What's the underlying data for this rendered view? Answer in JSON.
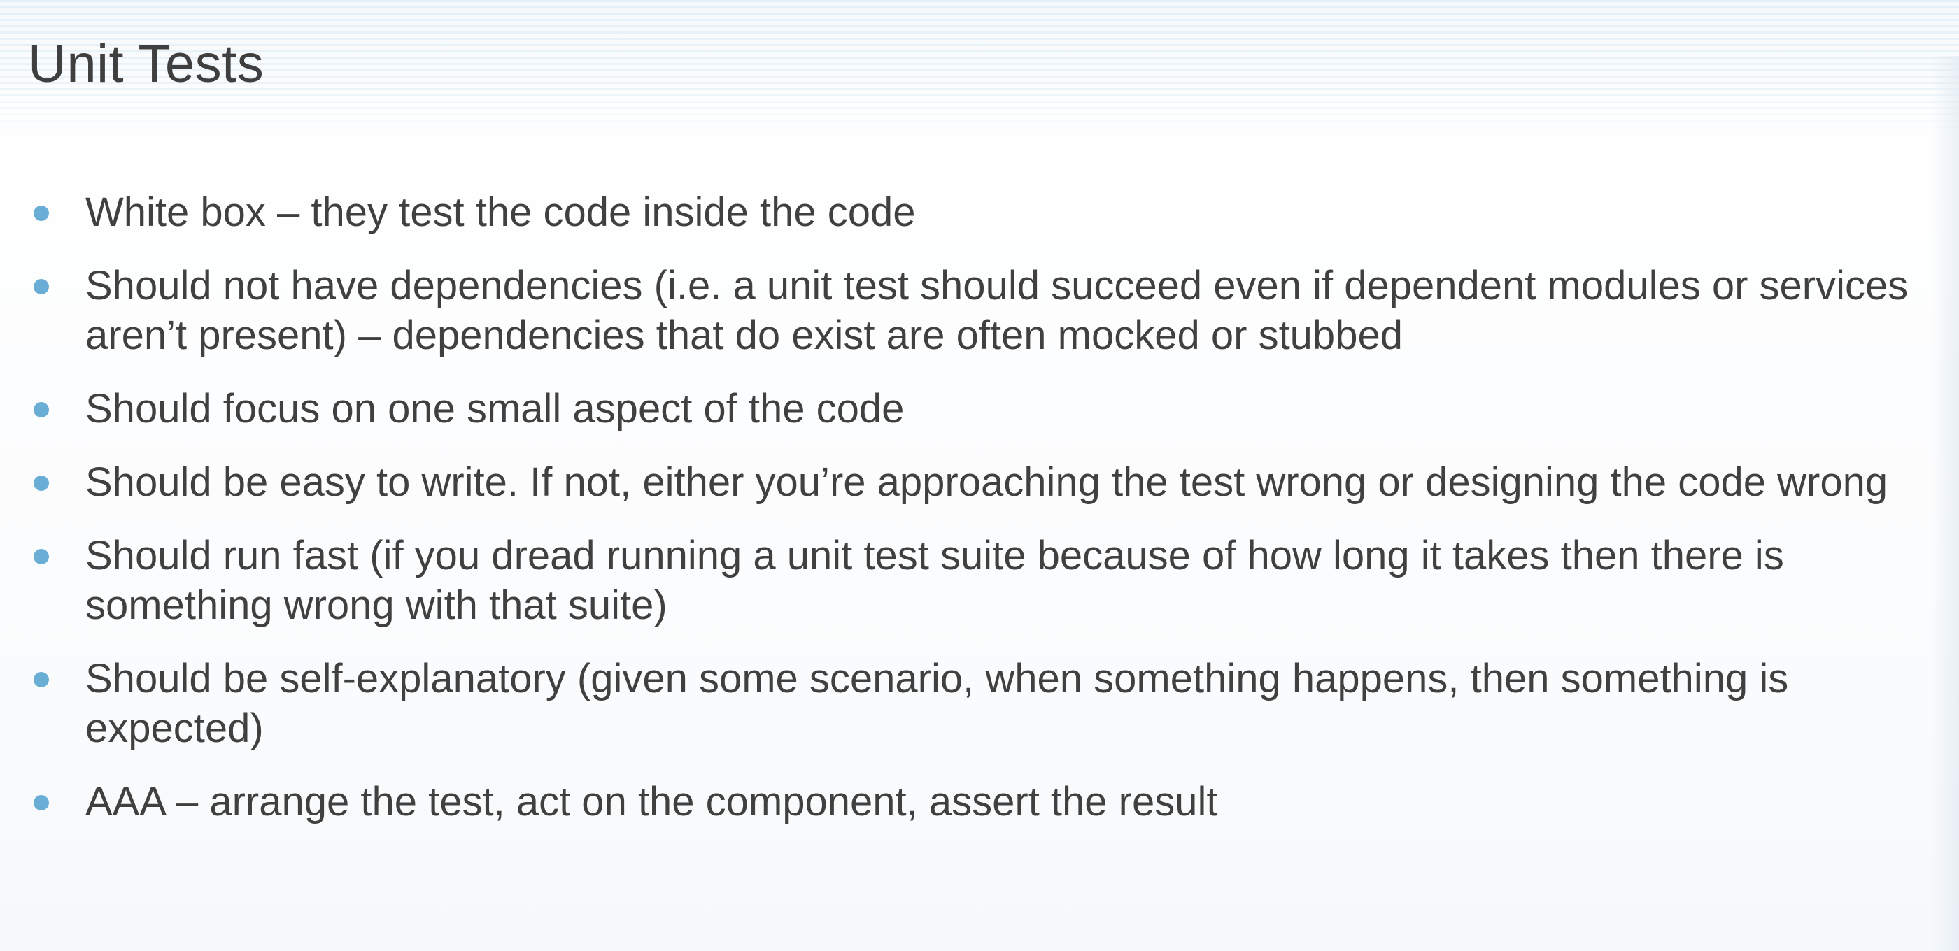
{
  "slide": {
    "title": "Unit Tests",
    "bullets": [
      "White box – they test the code inside the code",
      "Should not have dependencies (i.e. a unit test should succeed even if dependent modules or services aren’t present) – dependencies that do exist are often mocked or stubbed",
      "Should focus on one small aspect of the code",
      "Should be easy to write. If not, either you’re approaching the test wrong or designing the code wrong",
      "Should run fast (if you dread running a unit test suite because of how long it takes then there is something wrong with that suite)",
      "Should be self-explanatory (given some scenario, when something happens, then something is expected)",
      "AAA – arrange the test, act on the component, assert the result"
    ],
    "bullet_color": "#6aaed6",
    "title_color": "#3f3f3f",
    "text_color": "#404040"
  }
}
